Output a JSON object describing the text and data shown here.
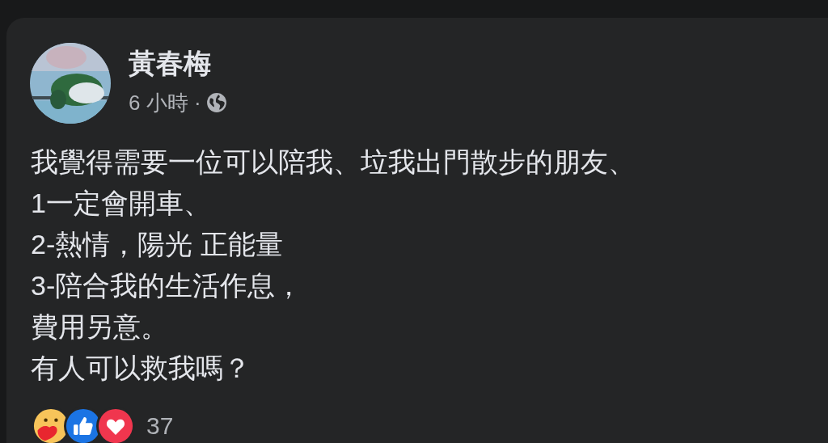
{
  "post": {
    "author": "黃春梅",
    "time": "6 小時 ·",
    "lines": [
      "我覺得需要一位可以陪我、垃我出門散步的朋友、",
      "1一定會開車、",
      "2-熱情，陽光 正能量",
      "3-陪合我的生活作息，",
      "費用另意。",
      "有人可以救我嗎？"
    ],
    "reactions": [
      {
        "kind": "care"
      },
      {
        "kind": "like"
      },
      {
        "kind": "love"
      }
    ],
    "reaction_count": "37"
  }
}
